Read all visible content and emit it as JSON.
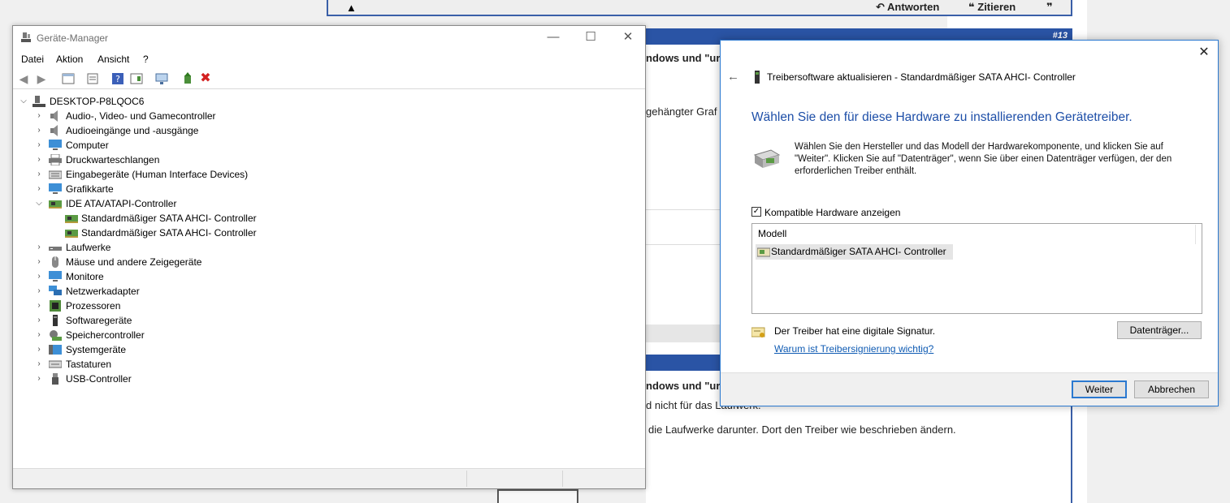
{
  "forum": {
    "actions": {
      "reply": "Antworten",
      "quote": "Zitieren"
    },
    "post_number": "#13",
    "snippet_top_title": "ndows und \"ur",
    "snippet_line1": "gehängter Graf",
    "snippet_bottom_title": "ndows und \"ur",
    "snippet_line2": "d nicht für das Laufwerk.",
    "snippet_line3": "die Laufwerke darunter. Dort den Treiber wie beschrieben ändern."
  },
  "device_manager": {
    "title": "Geräte-Manager",
    "window_controls": {
      "minimize": "—",
      "maximize": "☐",
      "close": "✕"
    },
    "menu": [
      "Datei",
      "Aktion",
      "Ansicht",
      "?"
    ],
    "root": "DESKTOP-P8LQOC6",
    "items": [
      {
        "label": "Audio-, Video- und Gamecontroller",
        "icon": "speaker-icon"
      },
      {
        "label": "Audioeingänge und -ausgänge",
        "icon": "speaker-icon"
      },
      {
        "label": "Computer",
        "icon": "monitor-icon"
      },
      {
        "label": "Druckwarteschlangen",
        "icon": "printer-icon"
      },
      {
        "label": "Eingabegeräte (Human Interface Devices)",
        "icon": "keyboard-icon"
      },
      {
        "label": "Grafikkarte",
        "icon": "monitor-icon"
      },
      {
        "label": "IDE ATA/ATAPI-Controller",
        "icon": "controller-card-icon"
      },
      {
        "label": "Standardmäßiger SATA AHCI- Controller",
        "icon": "controller-card-icon"
      },
      {
        "label": "Standardmäßiger SATA AHCI- Controller",
        "icon": "controller-card-icon"
      },
      {
        "label": "Laufwerke",
        "icon": "drive-icon"
      },
      {
        "label": "Mäuse und andere Zeigegeräte",
        "icon": "mouse-icon"
      },
      {
        "label": "Monitore",
        "icon": "monitor-icon"
      },
      {
        "label": "Netzwerkadapter",
        "icon": "network-icon"
      },
      {
        "label": "Prozessoren",
        "icon": "chip-icon"
      },
      {
        "label": "Softwaregeräte",
        "icon": "software-device-icon"
      },
      {
        "label": "Speichercontroller",
        "icon": "storage-icon"
      },
      {
        "label": "Systemgeräte",
        "icon": "system-icon"
      },
      {
        "label": "Tastaturen",
        "icon": "keyboard-icon"
      },
      {
        "label": "USB-Controller",
        "icon": "usb-icon"
      }
    ]
  },
  "driver_dialog": {
    "close": "✕",
    "header": "Treibersoftware aktualisieren - Standardmäßiger SATA AHCI- Controller",
    "heading": "Wählen Sie den für diese Hardware zu installierenden Gerätetreiber.",
    "description": "Wählen Sie den Hersteller und das Modell der Hardwarekomponente, und klicken Sie auf \"Weiter\". Klicken Sie auf \"Datenträger\", wenn Sie über einen Datenträger verfügen, der den erforderlichen Treiber enthält.",
    "checkbox_label": "Kompatible Hardware anzeigen",
    "checkbox_checked": true,
    "list_header": "Modell",
    "list_items": [
      "Standardmäßiger SATA AHCI- Controller"
    ],
    "signature_text": "Der Treiber hat eine digitale Signatur.",
    "signature_link": "Warum ist Treibersignierung wichtig?",
    "disk_button": "Datenträger...",
    "next_button": "Weiter",
    "cancel_button": "Abbrechen"
  },
  "colors": {
    "accent": "#1e4fa8",
    "link": "#0f5bb3",
    "forum_blue": "#2a54a5",
    "dialog_border": "#2b79d0"
  }
}
